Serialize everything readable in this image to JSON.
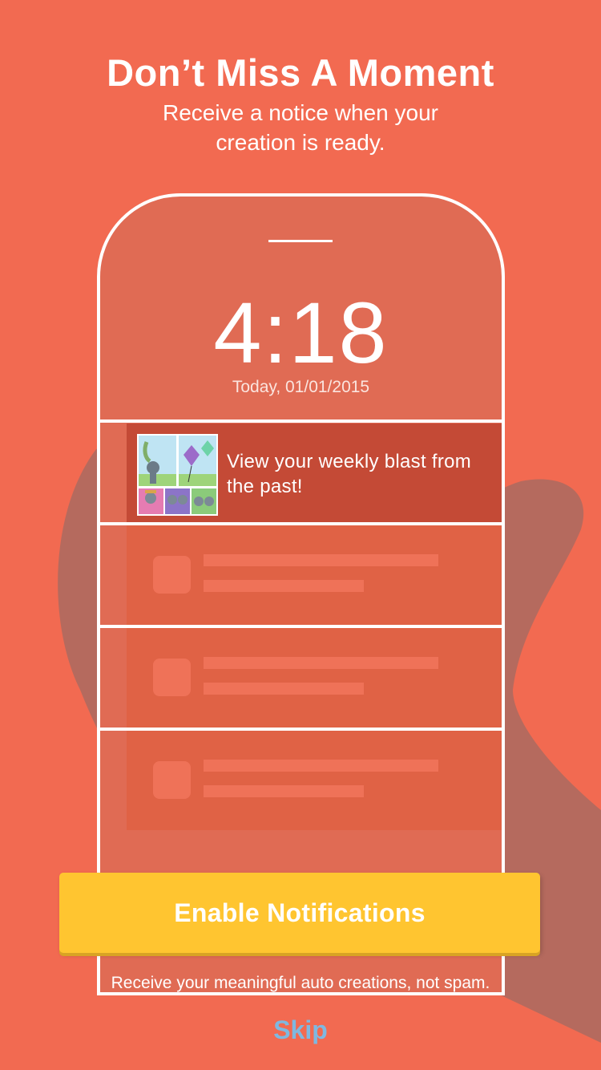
{
  "onboarding": {
    "title": "Don’t Miss A Moment",
    "subtitle": "Receive a notice when your creation is ready."
  },
  "lock_screen": {
    "time": "4:18",
    "date": "Today, 01/01/2015",
    "notification": {
      "text": "View your weekly blast from the past!",
      "thumbnail_icon": "kite-collage-thumbnail"
    },
    "placeholder_cards": 3
  },
  "actions": {
    "enable_label": "Enable Notifications",
    "note": "Receive your meaningful auto creations, not spam.",
    "skip_label": "Skip"
  },
  "colors": {
    "background": "#F26A51",
    "hand_shadow": "#B56A5E",
    "phone_fill": "#E06B54",
    "notification_fill": "#C44A36",
    "placeholder_fill": "#E06245",
    "button_fill": "#FFC530",
    "skip_text": "#7FB8E0"
  }
}
